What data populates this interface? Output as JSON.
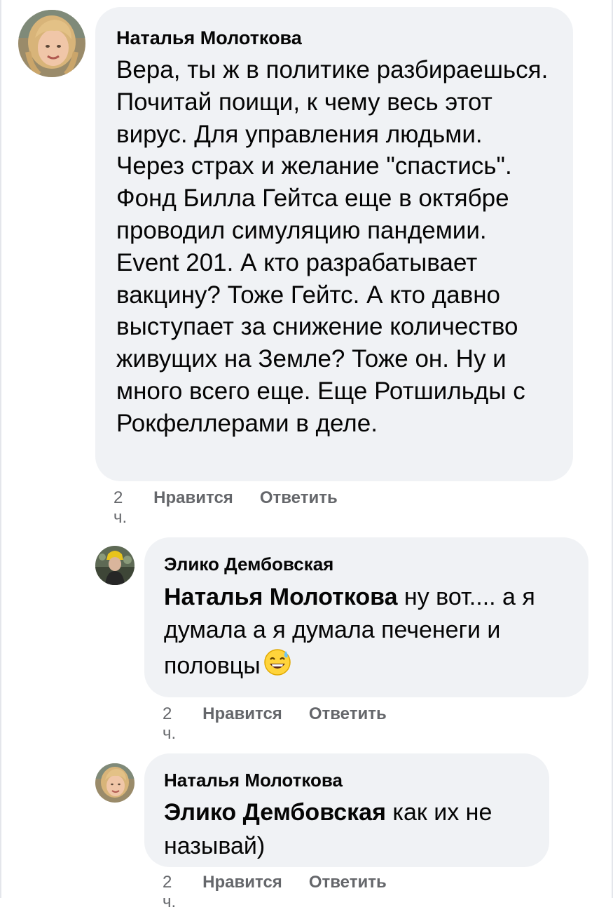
{
  "comments": [
    {
      "author": "Наталья Молоткова",
      "mention": "",
      "text": "Вера, ты ж в политике разбираешься. Почитай поищи, к чему весь этот вирус. Для управления людьми. Через страх и желание \"спастись\". Фонд Билла Гейтса еще в октябре проводил симуляцию пандемии. Event 201. А кто разрабатывает вакцину? Тоже Гейтс. А кто давно выступает за снижение количество живущих на Земле? Тоже он.  Ну и много всего еще. Еще Ротшильды с Рокфеллерами в деле.",
      "time": "2 ч.",
      "like_label": "Нравится",
      "reply_label": "Ответить"
    },
    {
      "author": "Элико Дембовская",
      "mention": "Наталья Молоткова",
      "text": " ну вот.... а я думала а я думала печенеги и половцы",
      "emoji": "sweat-smile-emoji",
      "time": "2 ч.",
      "like_label": "Нравится",
      "reply_label": "Ответить"
    },
    {
      "author": "Наталья Молоткова",
      "mention": "Элико Дембовская",
      "text": " как их не называй)",
      "time": "2 ч.",
      "like_label": "Нравится",
      "reply_label": "Ответить"
    }
  ],
  "colors": {
    "bubble": "#f0f2f5",
    "text": "#050505",
    "meta": "#65676b"
  }
}
